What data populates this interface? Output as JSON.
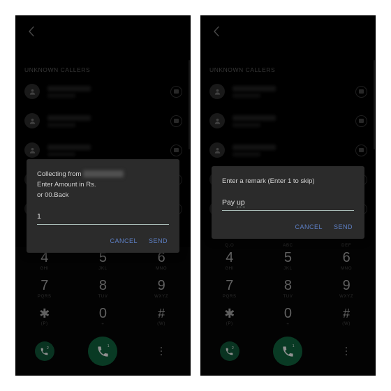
{
  "theme": {
    "page_background": "#ffffff",
    "phone_background": "#000000",
    "dialog_background": "#2b2b2b",
    "dialog_button_color": "#5d7fc4",
    "field_underline_color": "#a9bcb7",
    "call_button_green": "#0e5434",
    "digit_color": "#8a8a8a",
    "letters_color": "#414141"
  },
  "panels": [
    {
      "id": "left",
      "name": "collect-amount-screen",
      "topbar": {
        "back_icon": "chevron-left-icon"
      },
      "list": {
        "section_label": "UNKNOWN CALLERS",
        "rows": [
          {
            "avatar_icon": "person-icon",
            "name": "",
            "subtitle": "",
            "action_icon": "message-icon",
            "redacted": true
          },
          {
            "avatar_icon": "person-icon",
            "name": "",
            "subtitle": "",
            "action_icon": "message-icon",
            "redacted": true
          },
          {
            "avatar_icon": "person-icon",
            "name": "",
            "subtitle": "",
            "action_icon": "message-icon",
            "redacted": true
          },
          {
            "avatar_icon": "person-icon",
            "name": "",
            "subtitle": "",
            "action_icon": "message-icon",
            "redacted": true
          },
          {
            "avatar_icon": "person-icon",
            "name": "",
            "subtitle": "",
            "action_icon": "message-icon",
            "redacted": true
          }
        ]
      },
      "dialog": {
        "title_lines": [
          "Collecting from",
          "Enter Amount in Rs.",
          " or 00.Back"
        ],
        "name_redacted": true,
        "input_value": "1",
        "input_misspelled": "",
        "cancel_label": "CANCEL",
        "send_label": "SEND"
      },
      "dialpad": {
        "keys": [
          {
            "digit": "4",
            "letters": "GHI"
          },
          {
            "digit": "5",
            "letters": "JKL"
          },
          {
            "digit": "6",
            "letters": "MNO"
          },
          {
            "digit": "7",
            "letters": "PQRS"
          },
          {
            "digit": "8",
            "letters": "TUV"
          },
          {
            "digit": "9",
            "letters": "WXYZ"
          },
          {
            "digit": "✱",
            "letters": "(P)"
          },
          {
            "digit": "0",
            "letters": "+"
          },
          {
            "digit": "#",
            "letters": "(W)"
          }
        ],
        "actions": {
          "call_sim2_icon": "phone-call-icon",
          "call_sim2_badge": "2",
          "call_sim1_icon": "phone-call-icon",
          "call_sim1_badge": "1",
          "overflow_icon": "kebab-menu-icon"
        }
      }
    },
    {
      "id": "right",
      "name": "enter-remark-screen",
      "topbar": {
        "back_icon": "chevron-left-icon"
      },
      "list": {
        "section_label": "UNKNOWN CALLERS",
        "rows": [
          {
            "avatar_icon": "person-icon",
            "name": "",
            "subtitle": "",
            "action_icon": "message-icon",
            "redacted": true
          },
          {
            "avatar_icon": "person-icon",
            "name": "",
            "subtitle": "",
            "action_icon": "message-icon",
            "redacted": true
          },
          {
            "avatar_icon": "person-icon",
            "name": "",
            "subtitle": "",
            "action_icon": "message-icon",
            "redacted": true
          },
          {
            "avatar_icon": "person-icon",
            "name": "",
            "subtitle": "",
            "action_icon": "message-icon",
            "redacted": true
          },
          {
            "avatar_icon": "person-icon",
            "name": "",
            "subtitle": "",
            "action_icon": "message-icon",
            "redacted": true
          }
        ]
      },
      "dialog": {
        "title_lines": [
          "Enter a remark (Enter 1 to skip)"
        ],
        "name_redacted": false,
        "input_value": "Pay ",
        "input_misspelled": "up",
        "cancel_label": "CANCEL",
        "send_label": "SEND"
      },
      "dialpad": {
        "partial_row_letters": [
          "Q,O",
          "ABC",
          "DEF"
        ],
        "keys": [
          {
            "digit": "4",
            "letters": "GHI"
          },
          {
            "digit": "5",
            "letters": "JKL"
          },
          {
            "digit": "6",
            "letters": "MNO"
          },
          {
            "digit": "7",
            "letters": "PQRS"
          },
          {
            "digit": "8",
            "letters": "TUV"
          },
          {
            "digit": "9",
            "letters": "WXYZ"
          },
          {
            "digit": "✱",
            "letters": "(P)"
          },
          {
            "digit": "0",
            "letters": "+"
          },
          {
            "digit": "#",
            "letters": "(W)"
          }
        ],
        "actions": {
          "call_sim2_icon": "phone-call-icon",
          "call_sim2_badge": "2",
          "call_sim1_icon": "phone-call-icon",
          "call_sim1_badge": "1",
          "overflow_icon": "kebab-menu-icon"
        }
      }
    }
  ]
}
